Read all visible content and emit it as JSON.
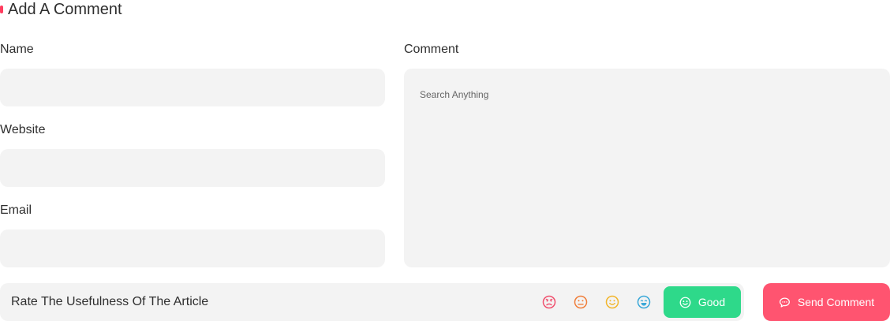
{
  "form": {
    "title": "Add A Comment",
    "accent_color": "#ff3d5f",
    "fields": {
      "name_label": "Name",
      "website_label": "Website",
      "email_label": "Email",
      "comment_label": "Comment",
      "comment_placeholder": "Search Anything"
    }
  },
  "rating": {
    "prompt": "Rate The Usefulness Of The Article",
    "options": [
      {
        "icon": "angry-face-icon",
        "color": "#f0506e"
      },
      {
        "icon": "neutral-face-icon",
        "color": "#f07e3a"
      },
      {
        "icon": "smile-face-icon",
        "color": "#f2b52a"
      },
      {
        "icon": "happy-face-icon",
        "color": "#3aa8d8"
      }
    ],
    "selected_label": "Good",
    "selected_icon": "smile-face-icon",
    "selected_color": "#2ed98a"
  },
  "actions": {
    "send_label": "Send Comment",
    "send_icon": "chat-bubble-icon",
    "send_color": "#ff5470"
  }
}
